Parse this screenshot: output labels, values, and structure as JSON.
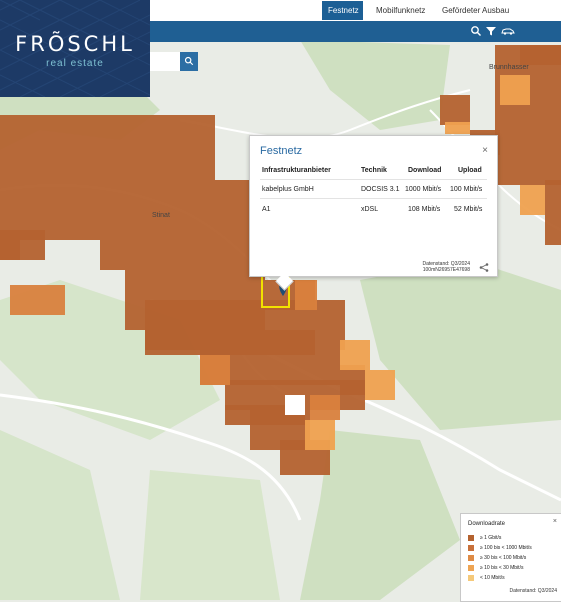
{
  "nav": {
    "tabs": [
      {
        "label": "Festnetz",
        "active": true
      },
      {
        "label": "Mobilfunknetz",
        "active": false
      },
      {
        "label": "Gefördeter Ausbau",
        "active": false
      }
    ]
  },
  "logo": {
    "title": "FRÕSCHL",
    "subtitle": "real estate"
  },
  "tools": {
    "search_icon": "search-icon",
    "filter_icon": "filter-icon",
    "car_icon": "vehicle-icon"
  },
  "map": {
    "places": {
      "main_town": "Stinat",
      "north_east": "Brunnhasser"
    },
    "colors": {
      "background": "#e9ece6",
      "forest": "#cfe0c1",
      "tile_dark": "#b4622f",
      "tile_mid": "#d9813d",
      "tile_light": "#efa14f",
      "tile_pale": "#f4b768",
      "highlight": "#f2e200"
    }
  },
  "popup": {
    "title": "Festnetz",
    "headers": {
      "provider": "Infrastrukturanbieter",
      "tech": "Technik",
      "down": "Download",
      "up": "Upload"
    },
    "rows": [
      {
        "provider": "kabelplus GmbH",
        "tech": "DOCSIS 3.1",
        "down": "1000 Mbit/s",
        "up": "100 Mbit/s"
      },
      {
        "provider": "A1",
        "tech": "xDSL",
        "down": "108 Mbit/s",
        "up": "52 Mbit/s"
      }
    ],
    "datastand": "Datenstand: Q3/2024",
    "cell_id": "100mN26957E47698",
    "close": "×"
  },
  "legend": {
    "title": "Downloadrate",
    "close": "×",
    "items": [
      {
        "label": "≥ 1 Gbit/s",
        "color": "#b4622f"
      },
      {
        "label": "≥ 100 bis < 1000 Mbit/s",
        "color": "#c8703a"
      },
      {
        "label": "≥ 30 bis < 100 Mbit/s",
        "color": "#de8a45"
      },
      {
        "label": "≥ 10 bis < 30 Mbit/s",
        "color": "#eea453"
      },
      {
        "label": "< 10 Mbit/s",
        "color": "#f5c97a"
      }
    ],
    "datastand": "Datenstand: Q3/2024"
  }
}
